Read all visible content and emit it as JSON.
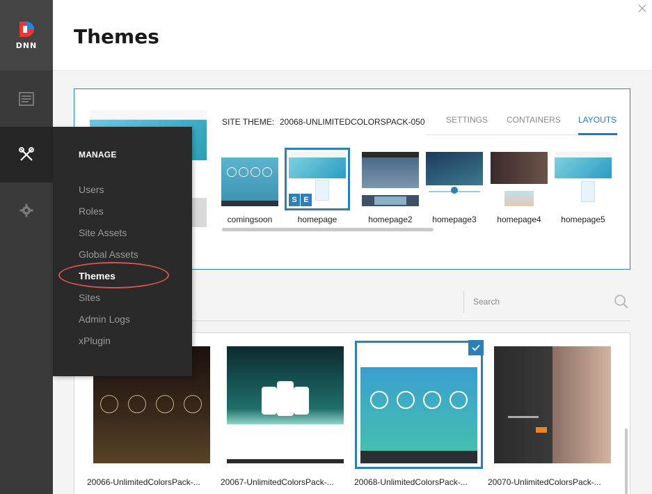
{
  "brand": {
    "logo_text": "DNN"
  },
  "header": {
    "title": "Themes"
  },
  "site_theme": {
    "label": "SITE THEME:",
    "name": "20068-UNLIMITEDCOLORSPACK-050",
    "tabs": [
      {
        "label": "SETTINGS",
        "active": false
      },
      {
        "label": "CONTAINERS",
        "active": false
      },
      {
        "label": "LAYOUTS",
        "active": true
      }
    ],
    "layouts": [
      {
        "label": "comingsoon",
        "selected": false
      },
      {
        "label": "homepage",
        "selected": true,
        "badge": [
          "S",
          "E"
        ]
      },
      {
        "label": "homepage2",
        "selected": false
      },
      {
        "label": "homepage3",
        "selected": false
      },
      {
        "label": "homepage4",
        "selected": false
      },
      {
        "label": "homepage5",
        "selected": false
      }
    ]
  },
  "search": {
    "placeholder": "Search"
  },
  "themes": [
    {
      "label": "20066-UnlimitedColorsPack-...",
      "selected": false
    },
    {
      "label": "20067-UnlimitedColorsPack-...",
      "selected": false
    },
    {
      "label": "20068-UnlimitedColorsPack-...",
      "selected": true
    },
    {
      "label": "20070-UnlimitedColorsPack-...",
      "selected": false
    }
  ],
  "manage_menu": {
    "title": "MANAGE",
    "items": [
      {
        "label": "Users"
      },
      {
        "label": "Roles"
      },
      {
        "label": "Site Assets"
      },
      {
        "label": "Global Assets"
      },
      {
        "label": "Themes",
        "active": true
      },
      {
        "label": "Sites"
      },
      {
        "label": "Admin Logs"
      },
      {
        "label": "xPlugin"
      }
    ]
  },
  "colors": {
    "accent": "#2d7fb8",
    "rail": "#3a3a3a",
    "flyout": "#2a2a2a",
    "highlight": "#d9534f"
  }
}
